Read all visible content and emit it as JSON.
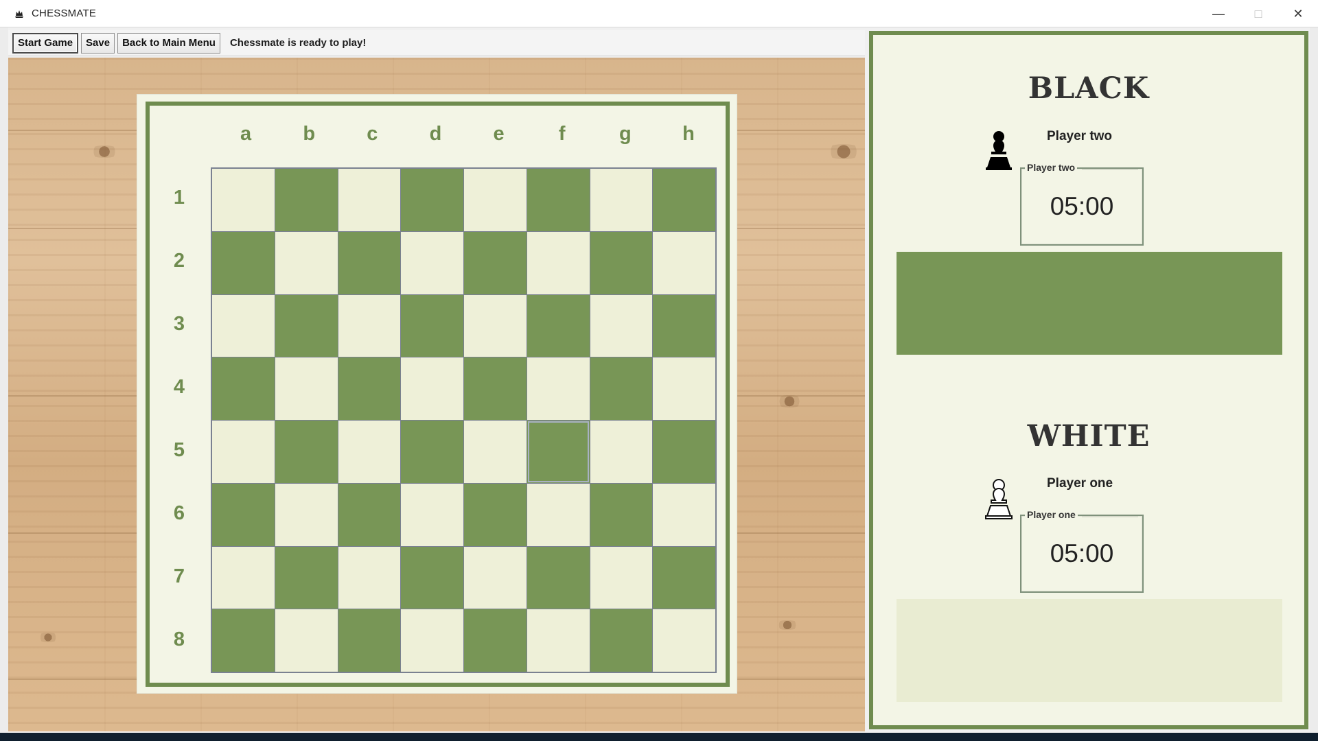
{
  "window": {
    "title": "CHESSMATE",
    "controls": {
      "minimize": "—",
      "maximize": "□",
      "close": "✕"
    }
  },
  "toolbar": {
    "start_game": "Start Game",
    "save": "Save",
    "back_to_main_menu": "Back to Main Menu",
    "status": "Chessmate is ready to play!"
  },
  "board": {
    "files": [
      "a",
      "b",
      "c",
      "d",
      "e",
      "f",
      "g",
      "h"
    ],
    "ranks": [
      "1",
      "2",
      "3",
      "4",
      "5",
      "6",
      "7",
      "8"
    ],
    "selected_square": "f5"
  },
  "players": {
    "black": {
      "side_title": "BLACK",
      "name": "Player two",
      "timer_caption": "Player two",
      "time": "05:00"
    },
    "white": {
      "side_title": "WHITE",
      "name": "Player one",
      "timer_caption": "Player one",
      "time": "05:00"
    }
  },
  "colors": {
    "accent_green": "#789656",
    "light_square": "#eef0d8",
    "panel_background": "#f3f5e6"
  },
  "icons": {
    "app": "chess-crown-icon",
    "black_player": "black-pawn-icon",
    "white_player": "white-pawn-icon"
  }
}
